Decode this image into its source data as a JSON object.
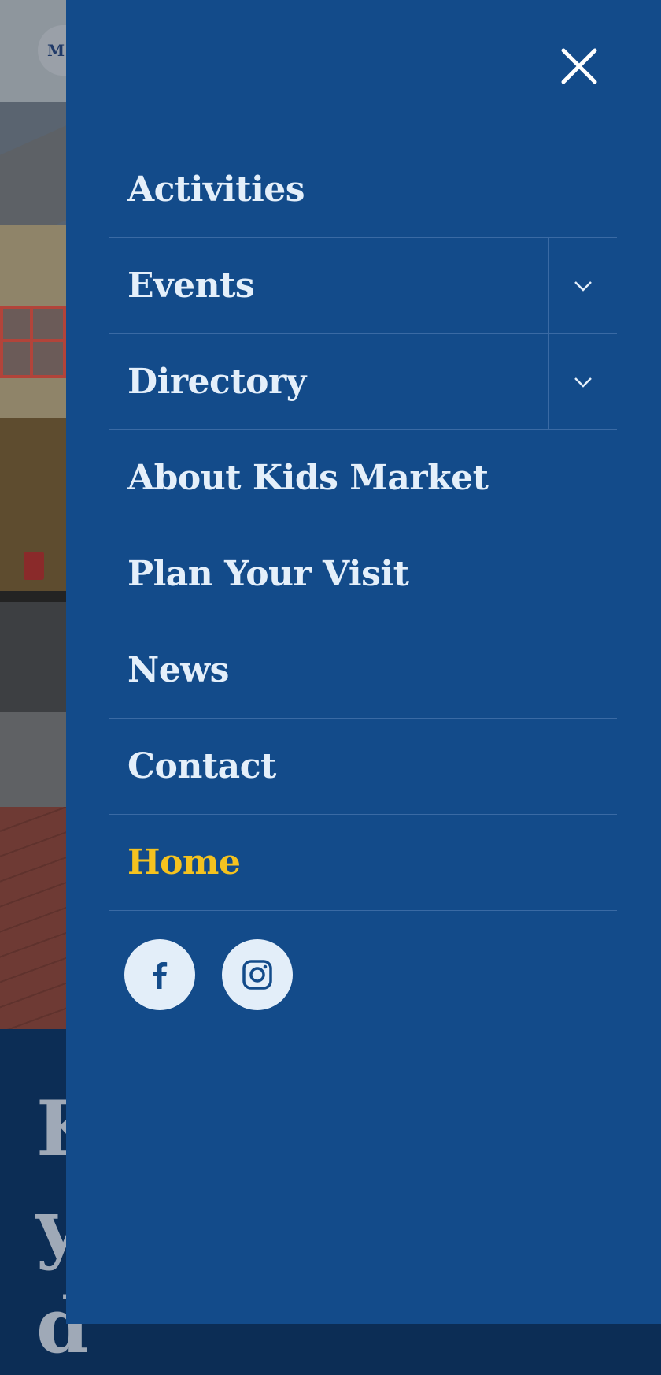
{
  "background": {
    "logo_text": "M",
    "hero_letters": [
      "K",
      "y",
      "d"
    ]
  },
  "drawer": {
    "close_label": "Close menu",
    "menu": [
      {
        "label": "Activities",
        "has_submenu": false,
        "active": false
      },
      {
        "label": "Events",
        "has_submenu": true,
        "active": false
      },
      {
        "label": "Directory",
        "has_submenu": true,
        "active": false
      },
      {
        "label": "About Kids Market",
        "has_submenu": false,
        "active": false
      },
      {
        "label": "Plan Your Visit",
        "has_submenu": false,
        "active": false
      },
      {
        "label": "News",
        "has_submenu": false,
        "active": false
      },
      {
        "label": "Contact",
        "has_submenu": false,
        "active": false
      },
      {
        "label": "Home",
        "has_submenu": false,
        "active": true
      }
    ],
    "socials": [
      {
        "icon": "facebook-icon"
      },
      {
        "icon": "instagram-icon"
      }
    ]
  },
  "colors": {
    "drawer_bg": "#134b8a",
    "menu_text": "#e4effa",
    "active_text": "#f4c21f",
    "divider": "#3a6aa4"
  }
}
